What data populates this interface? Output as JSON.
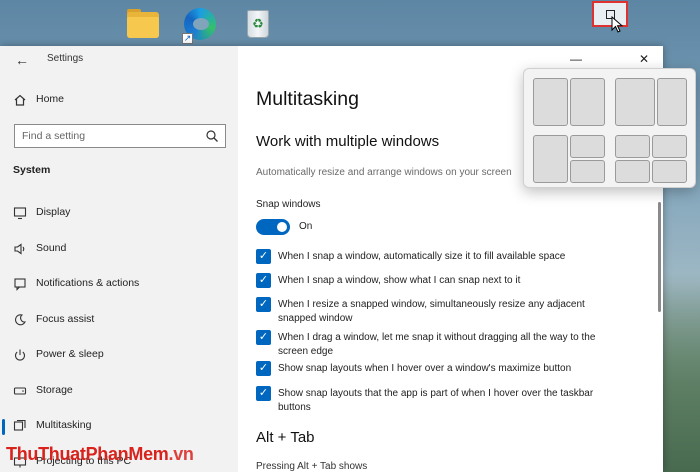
{
  "window": {
    "title": "Settings"
  },
  "sidebar": {
    "home_label": "Home",
    "search_placeholder": "Find a setting",
    "section_label": "System",
    "items": [
      {
        "label": "Display",
        "icon": "monitor-icon"
      },
      {
        "label": "Sound",
        "icon": "speaker-icon"
      },
      {
        "label": "Notifications & actions",
        "icon": "notification-icon"
      },
      {
        "label": "Focus assist",
        "icon": "moon-icon"
      },
      {
        "label": "Power & sleep",
        "icon": "power-icon"
      },
      {
        "label": "Storage",
        "icon": "drive-icon"
      },
      {
        "label": "Multitasking",
        "icon": "multitasking-icon"
      },
      {
        "label": "Projecting to this PC",
        "icon": "projector-icon"
      }
    ],
    "active_item": "Multitasking"
  },
  "main": {
    "page_title": "Multitasking",
    "section_title": "Work with multiple windows",
    "section_description": "Automatically resize and arrange windows on your screen",
    "snap_windows_label": "Snap windows",
    "snap_windows_state": "On",
    "options": [
      {
        "text": "When I snap a window, automatically size it to fill available space",
        "checked": true
      },
      {
        "text": "When I snap a window, show what I can snap next to it",
        "checked": true
      },
      {
        "text": "When I resize a snapped window, simultaneously resize any adjacent snapped window",
        "checked": true
      },
      {
        "text": "When I drag a window, let me snap it without dragging all the way to the screen edge",
        "checked": true
      },
      {
        "text": "Show snap layouts when I hover over a window's maximize button",
        "checked": true
      },
      {
        "text": "Show snap layouts that the app is part of when I hover over the taskbar buttons",
        "checked": true
      }
    ],
    "alt_tab_title": "Alt + Tab",
    "alt_tab_description": "Pressing Alt + Tab shows"
  },
  "colors": {
    "accent": "#0067c0",
    "highlight_border": "#e03131",
    "watermark": "#d9221c"
  },
  "watermark": {
    "brand": "ThuThuatPhanMem",
    "suffix": ".vn"
  }
}
